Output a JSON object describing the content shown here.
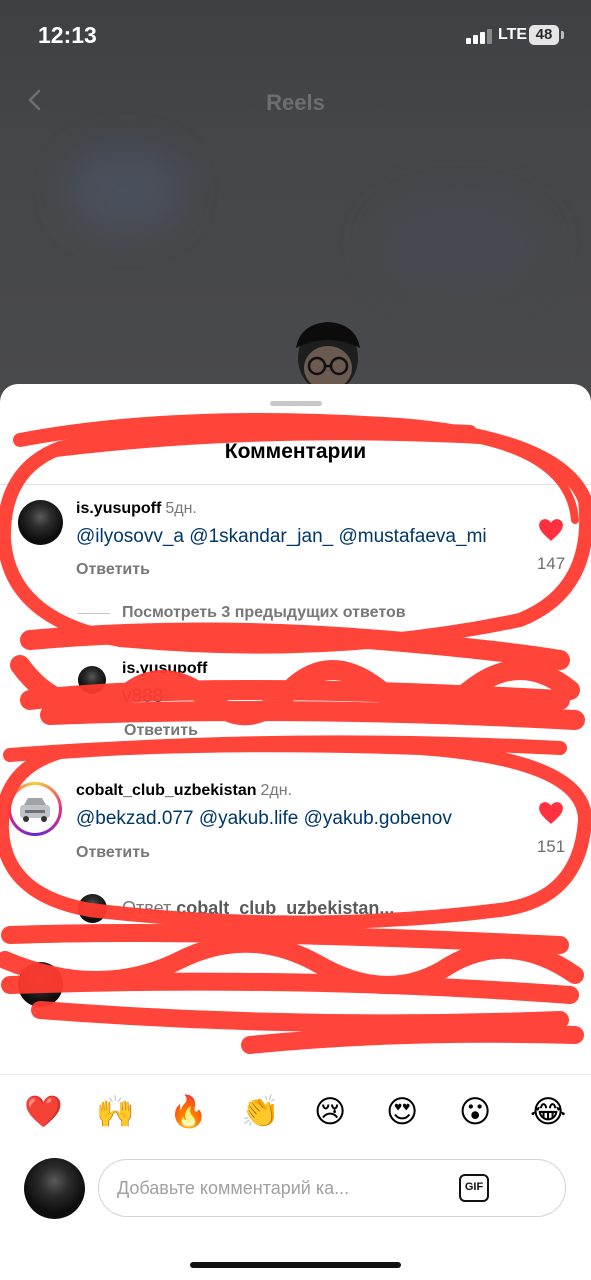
{
  "status_bar": {
    "time": "12:13",
    "network": "LTE",
    "battery": "48"
  },
  "header": {
    "title": "Reels"
  },
  "sheet": {
    "title": "Комментарии"
  },
  "comments": [
    {
      "username": "is.yusupoff",
      "age": "5дн.",
      "text": "@ilyosovv_a @1skandar_jan_ @mustafaeva_mi",
      "reply_label": "Ответить",
      "likes": "147",
      "view_replies": "Посмотреть 3 предыдущих ответов"
    },
    {
      "username": "is.yusupoff",
      "age": "",
      "text": "v888",
      "reply_label": "Ответить"
    },
    {
      "username": "cobalt_club_uzbekistan",
      "age": "2дн.",
      "text": "@bekzad.077 @yakub.life @yakub.gobenov",
      "reply_label": "Ответить",
      "likes": "151",
      "reply_preview_prefix": "Ответ",
      "reply_preview_user": "cobalt_club_uzbekistan..."
    }
  ],
  "emoji_bar": [
    "❤️",
    "🙌",
    "🔥",
    "👏",
    "😢",
    "😍",
    "😮",
    "😂"
  ],
  "comment_input": {
    "placeholder": "Добавьте комментарий ка...",
    "gif_label": "GIF"
  },
  "colors": {
    "mention": "#00376b",
    "heart": "#ff3040",
    "scribble": "#ff3b30"
  }
}
